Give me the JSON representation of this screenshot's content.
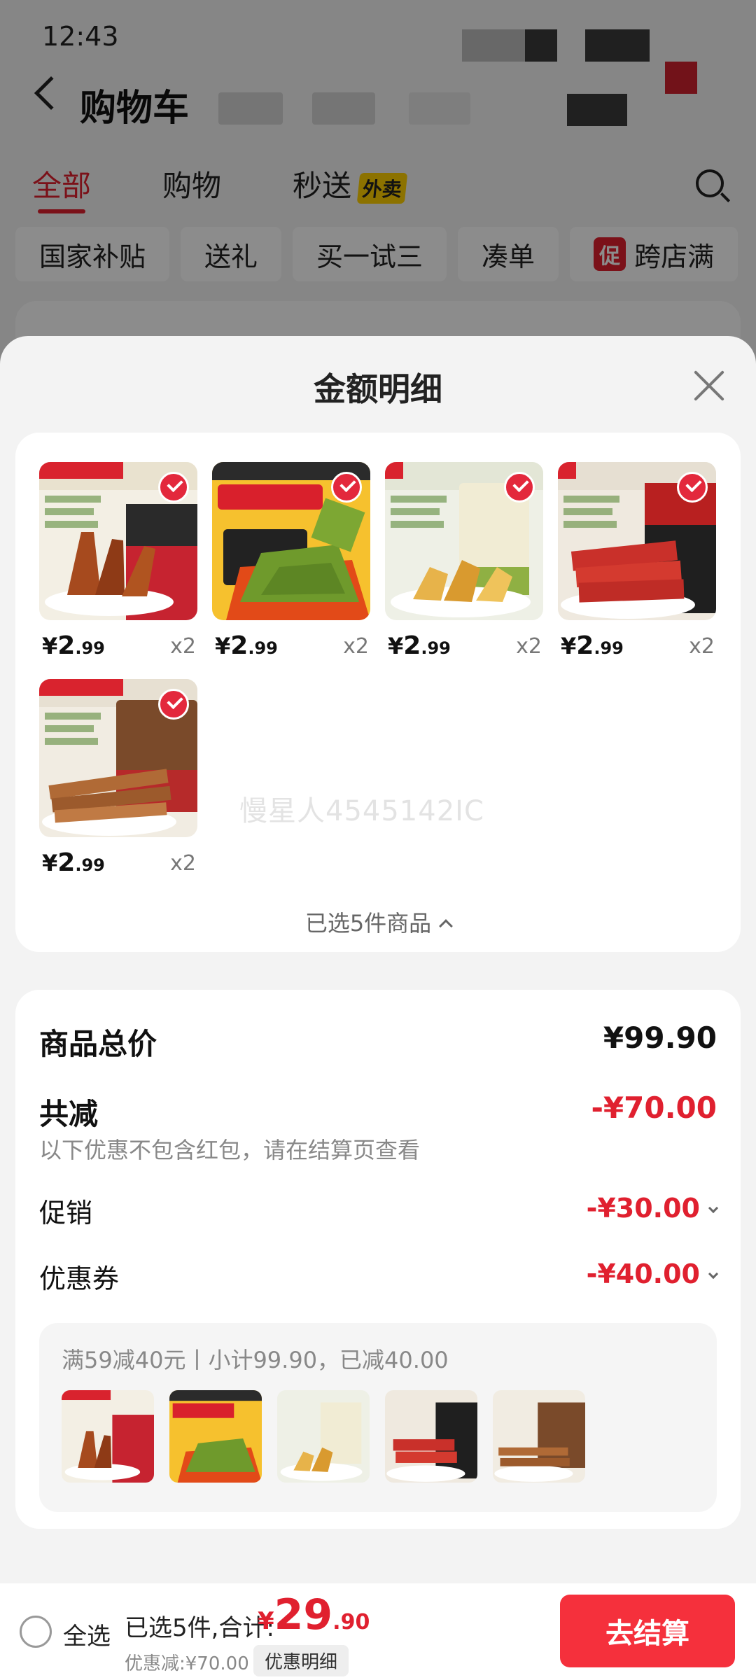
{
  "status": {
    "time": "12:43"
  },
  "header": {
    "title": "购物车"
  },
  "tabs": [
    {
      "label": "全部"
    },
    {
      "label": "购物"
    },
    {
      "label": "秒送",
      "badge": "外卖"
    }
  ],
  "chips": [
    {
      "label": "国家补贴"
    },
    {
      "label": "送礼"
    },
    {
      "label": "买一试三"
    },
    {
      "label": "凑单"
    },
    {
      "label": "跨店满",
      "tag": "促"
    }
  ],
  "sheet": {
    "title": "金额明细",
    "items": [
      {
        "price_int": "2",
        "price_dec": ".99",
        "qty": "x2",
        "theme": "duck"
      },
      {
        "price_int": "2",
        "price_dec": ".99",
        "qty": "x2",
        "theme": "kelp"
      },
      {
        "price_int": "2",
        "price_dec": ".99",
        "qty": "x2",
        "theme": "chicken_feet"
      },
      {
        "price_int": "2",
        "price_dec": ".99",
        "qty": "x2",
        "theme": "jerky"
      },
      {
        "price_int": "2",
        "price_dec": ".99",
        "qty": "x2",
        "theme": "chicken_strips"
      }
    ],
    "currency": "¥",
    "watermark": "慢星人4545142IC",
    "selected_text": "已选5件商品"
  },
  "summary": {
    "total_label": "商品总价",
    "total_value": "¥99.90",
    "reduce_label": "共减",
    "reduce_value": "-¥70.00",
    "note": "以下优惠不包含红包，请在结算页查看",
    "promo_label": "促销",
    "promo_value": "-¥30.00",
    "coupon_label": "优惠券",
    "coupon_value": "-¥40.00",
    "coupon_desc": "满59减40元丨小计99.90，已减40.00"
  },
  "bottom": {
    "select_all": "全选",
    "summary_text": "已选5件,合计:",
    "total_currency": "¥",
    "total_int": "29",
    "total_dec": ".90",
    "discount": "优惠减:¥70.00",
    "detail_button": "优惠明细",
    "checkout": "去结算"
  },
  "colors": {
    "accent": "#e0202f",
    "checkout": "#f5303c"
  }
}
